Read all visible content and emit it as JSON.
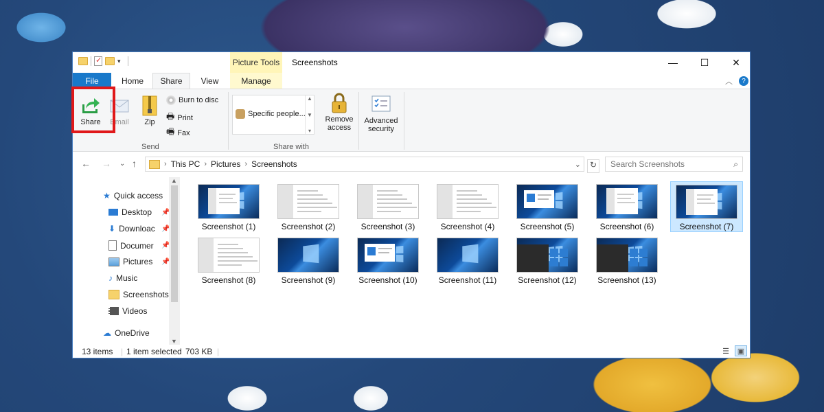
{
  "window": {
    "title": "Screenshots",
    "context_tab_header": "Picture Tools",
    "controls": {
      "minimize": "—",
      "maximize": "☐",
      "close": "✕"
    }
  },
  "tabs": [
    {
      "label": "File"
    },
    {
      "label": "Home"
    },
    {
      "label": "Share",
      "active": true
    },
    {
      "label": "View"
    },
    {
      "label": "Manage"
    }
  ],
  "ribbon": {
    "send_group": {
      "label": "Send",
      "share": "Share",
      "email": "Email",
      "zip": "Zip",
      "burn": "Burn to disc",
      "print": "Print",
      "fax": "Fax"
    },
    "share_with_group": {
      "label": "Share with",
      "gallery_item": "Specific people...",
      "remove_access_line1": "Remove",
      "remove_access_line2": "access"
    },
    "advanced_security_line1": "Advanced",
    "advanced_security_line2": "security"
  },
  "address": {
    "breadcrumbs": [
      "This PC",
      "Pictures",
      "Screenshots"
    ],
    "search_placeholder": "Search Screenshots"
  },
  "nav": {
    "items": [
      {
        "label": "Quick access",
        "icon": "star-icon"
      },
      {
        "label": "Desktop",
        "icon": "desktop-icon",
        "pinned": true
      },
      {
        "label": "Downloads",
        "icon": "download-icon",
        "pinned": true
      },
      {
        "label": "Documents",
        "icon": "documents-icon",
        "pinned": true
      },
      {
        "label": "Pictures",
        "icon": "pictures-icon",
        "pinned": true
      },
      {
        "label": "Music",
        "icon": "music-icon"
      },
      {
        "label": "Screenshots",
        "icon": "folder-icon"
      },
      {
        "label": "Videos",
        "icon": "videos-icon"
      },
      {
        "label": "OneDrive",
        "icon": "cloud-icon"
      }
    ],
    "nav_display": [
      "Quick access",
      "Desktop",
      "Downloac",
      "Documer",
      "Pictures",
      "Music",
      "Screenshots",
      "Videos",
      "OneDrive"
    ]
  },
  "files": [
    {
      "name": "Screenshot (1)",
      "style": "settings-desktop"
    },
    {
      "name": "Screenshot (2)",
      "style": "settings"
    },
    {
      "name": "Screenshot (3)",
      "style": "settings"
    },
    {
      "name": "Screenshot (4)",
      "style": "settings"
    },
    {
      "name": "Screenshot (5)",
      "style": "dialog-desktop"
    },
    {
      "name": "Screenshot (6)",
      "style": "settings-desktop"
    },
    {
      "name": "Screenshot (7)",
      "style": "settings-desktop",
      "selected": true
    },
    {
      "name": "Screenshot (8)",
      "style": "settings"
    },
    {
      "name": "Screenshot (9)",
      "style": "desktop"
    },
    {
      "name": "Screenshot (10)",
      "style": "dialog-desktop"
    },
    {
      "name": "Screenshot (11)",
      "style": "desktop"
    },
    {
      "name": "Screenshot (12)",
      "style": "startmenu"
    },
    {
      "name": "Screenshot (13)",
      "style": "startmenu"
    }
  ],
  "status": {
    "count": "13 items",
    "selection": "1 item selected",
    "size": "703 KB"
  },
  "colors": {
    "file_tab": "#1979ca",
    "context_tab": "#fff5b8",
    "highlight_box": "#e0181a",
    "selection": "#cce8ff"
  }
}
